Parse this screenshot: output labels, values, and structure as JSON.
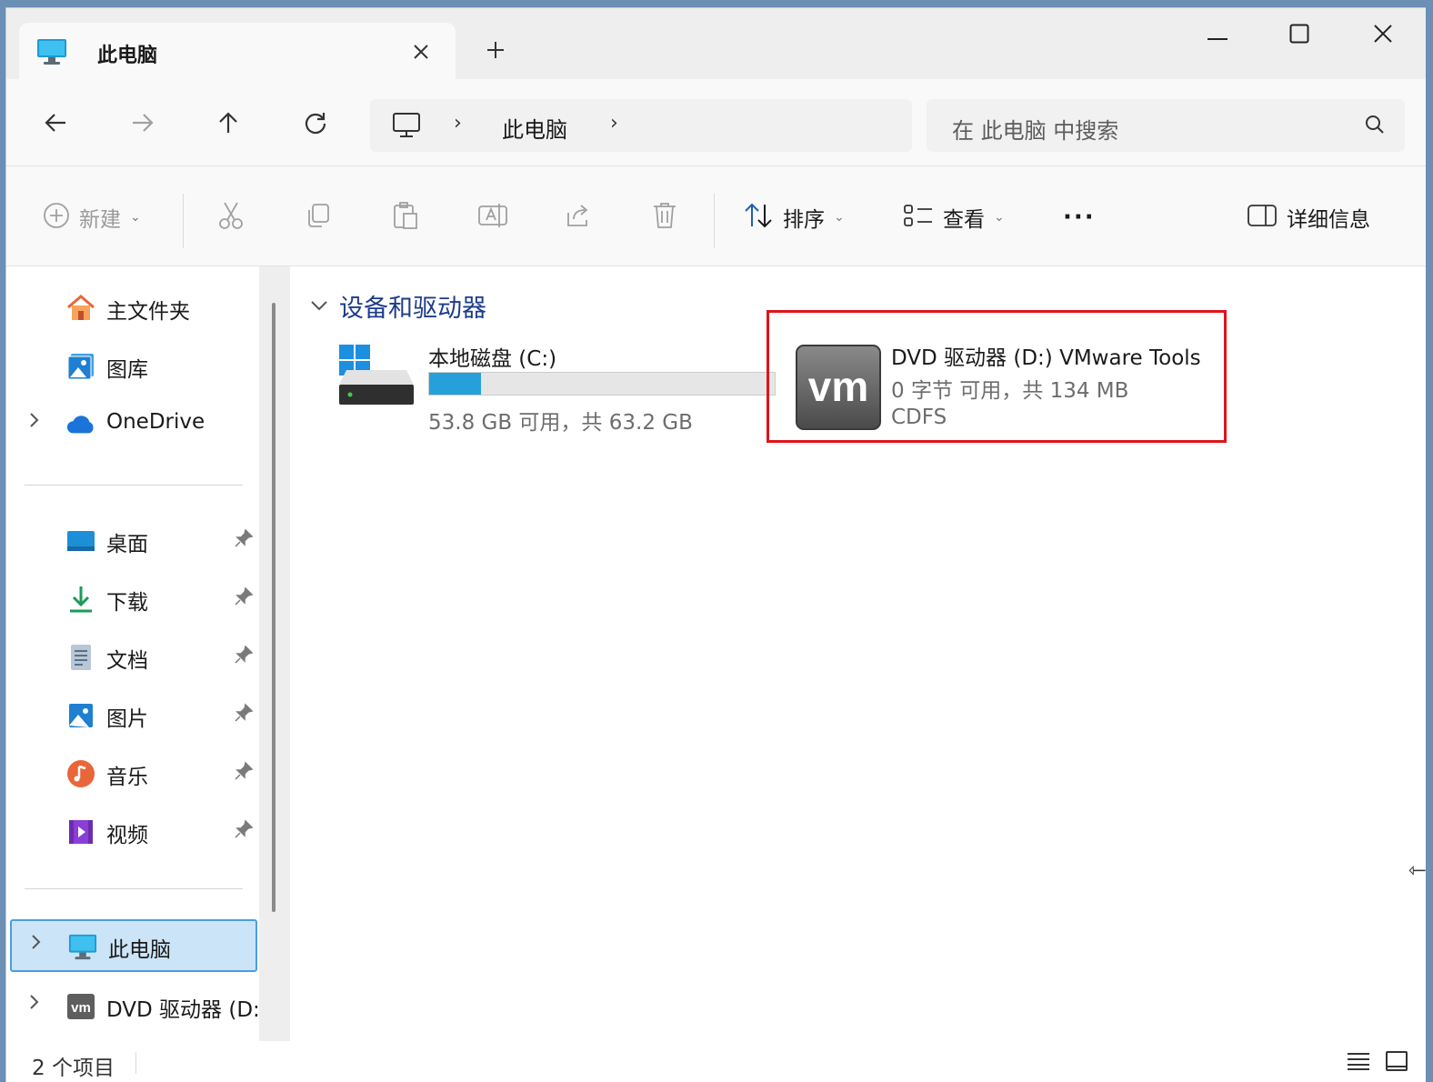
{
  "tab": {
    "title": "此电脑",
    "close_icon": "close-icon",
    "new_tab_label": "+"
  },
  "window_controls": {
    "minimize": "minimize-icon",
    "maximize": "maximize-icon",
    "close": "close-icon"
  },
  "address_bar": {
    "breadcrumb": [
      "此电脑"
    ],
    "separator": "›",
    "search_placeholder": "在 此电脑 中搜索"
  },
  "toolbar": {
    "new_label": "新建",
    "sort_label": "排序",
    "view_label": "查看",
    "more_label": "···",
    "details_label": "详细信息"
  },
  "sidebar": {
    "top_items": [
      {
        "label": "主文件夹",
        "icon": "home-icon"
      },
      {
        "label": "图库",
        "icon": "gallery-icon"
      },
      {
        "label": "OneDrive",
        "icon": "cloud-icon",
        "expandable": true
      }
    ],
    "pinned_items": [
      {
        "label": "桌面",
        "icon": "desktop-icon"
      },
      {
        "label": "下载",
        "icon": "download-icon"
      },
      {
        "label": "文档",
        "icon": "document-icon"
      },
      {
        "label": "图片",
        "icon": "pictures-icon"
      },
      {
        "label": "音乐",
        "icon": "music-icon"
      },
      {
        "label": "视频",
        "icon": "video-icon"
      }
    ],
    "bottom_items": [
      {
        "label": "此电脑",
        "icon": "computer-icon",
        "selected": true
      },
      {
        "label": "DVD 驱动器 (D:",
        "icon": "vmware-icon"
      }
    ]
  },
  "content": {
    "group_title": "设备和驱动器",
    "drives": [
      {
        "name": "本地磁盘 (C:)",
        "space": "53.8 GB 可用，共 63.2 GB",
        "used_fraction": 0.149,
        "icon": "windows-drive-icon"
      },
      {
        "name": "DVD 驱动器 (D:) VMware Tools",
        "space": "0 字节 可用，共 134 MB",
        "filesystem": "CDFS",
        "icon": "vmware-icon",
        "highlighted": true
      }
    ]
  },
  "status": {
    "item_count": "2 个项目"
  },
  "colors": {
    "accent": "#26a0da",
    "highlight_border": "#e0131b",
    "selected_bg": "#cce4f7",
    "group_title": "#1d3c8a"
  }
}
